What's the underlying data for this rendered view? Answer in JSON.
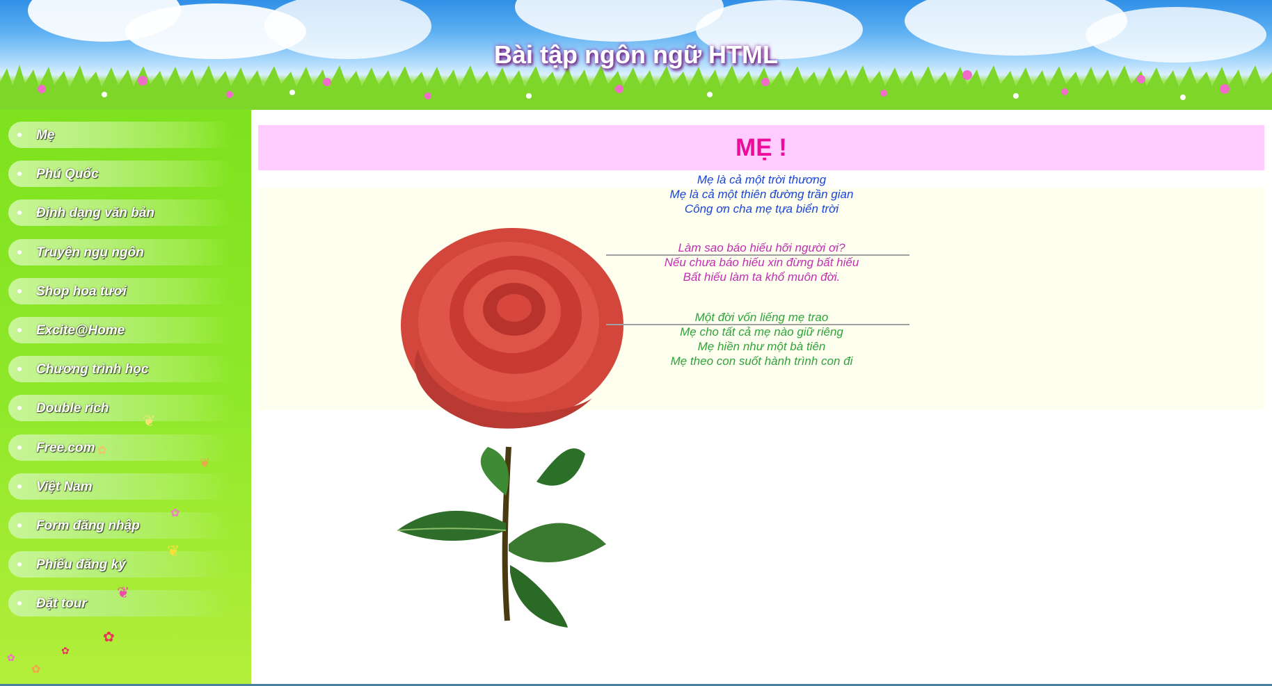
{
  "header": {
    "title": "Bài tập ngôn ngữ HTML"
  },
  "sidebar": {
    "items": [
      {
        "label": "Mẹ"
      },
      {
        "label": "Phú Quốc"
      },
      {
        "label": "Định dạng văn bản"
      },
      {
        "label": "Truyện ngụ ngôn"
      },
      {
        "label": "Shop hoa tươi"
      },
      {
        "label": "Excite@Home"
      },
      {
        "label": "Chương trình học"
      },
      {
        "label": "Double rich"
      },
      {
        "label": "Free.com"
      },
      {
        "label": "Việt Nam"
      },
      {
        "label": "Form đăng nhập"
      },
      {
        "label": "Phiếu đăng ký"
      },
      {
        "label": "Đặt tour"
      }
    ]
  },
  "main": {
    "title": "MẸ !",
    "poem": {
      "stanza1": [
        "Mẹ là cả một trời thương",
        "Mẹ là cả một thiên đường trần gian",
        "Công ơn cha mẹ tựa biển trời"
      ],
      "stanza2": [
        "Làm sao báo hiếu hỡi người ơi?",
        "Nếu chưa báo hiếu xin đừng bất hiếu",
        "Bất hiếu làm ta khổ muôn đời."
      ],
      "stanza3": [
        "Một đời vốn liếng mẹ trao",
        "Mẹ cho tất cả mẹ nào giữ riêng",
        "Mẹ hiền như một bà tiên",
        "Mẹ theo con suốt hành trình con đi"
      ]
    }
  },
  "colors": {
    "title_bg": "#ffccff",
    "title_text": "#ee0a9a",
    "poem_bg": "#fffff0",
    "stanza1": "#1a44d8",
    "stanza2": "#c02fb0",
    "stanza3": "#2ea33a",
    "sidebar_green": "#8fe82a"
  }
}
